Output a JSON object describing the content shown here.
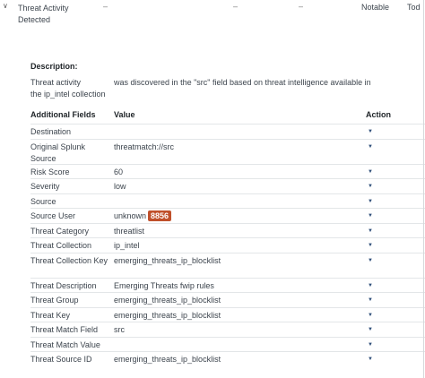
{
  "event": {
    "title_line1": "Threat Activity",
    "title_line2": "Detected",
    "dash": "–",
    "urgency": "Notable",
    "owner": "Tod"
  },
  "description": {
    "label": "Description:",
    "line1_a": "Threat activity",
    "line1_b": "was discovered in the \"src\" field based on threat intelligence available in",
    "line2": "the ip_intel collection"
  },
  "table": {
    "headers": {
      "field": "Additional Fields",
      "value": "Value",
      "action": "Action"
    },
    "action_icon": "caret-down-icon",
    "rows": [
      {
        "field": "Destination",
        "value": "",
        "action": "▼"
      },
      {
        "field": "Original Splunk Source",
        "value": "threatmatch://src",
        "action": "▼"
      },
      {
        "field": "Risk Score",
        "value": "60",
        "action": "▼"
      },
      {
        "field": "Severity",
        "value": "low",
        "action": "▼"
      },
      {
        "field": "Source",
        "value": "",
        "action": "▼"
      },
      {
        "field": "Source User",
        "value": "unknown",
        "badge": "8856",
        "action": "▼"
      },
      {
        "field": "Threat Category",
        "value": "threatlist",
        "action": "▼"
      },
      {
        "field": "Threat Collection",
        "value": "ip_intel",
        "action": "▼"
      },
      {
        "field": "Threat Collection Key",
        "value": "emerging_threats_ip_blocklist",
        "action": "▼"
      },
      {
        "field": "Threat Description",
        "value": "Emerging Threats fwip rules",
        "action": "▼"
      },
      {
        "field": "Threat Group",
        "value": "emerging_threats_ip_blocklist",
        "action": "▼"
      },
      {
        "field": "Threat Key",
        "value": "emerging_threats_ip_blocklist",
        "action": "▼"
      },
      {
        "field": "Threat Match Field",
        "value": "src",
        "action": "▼"
      },
      {
        "field": "Threat Match Value",
        "value": "",
        "action": "▼"
      },
      {
        "field": "Threat Source ID",
        "value": "emerging_threats_ip_blocklist",
        "action": "▼"
      }
    ]
  },
  "colors": {
    "badge": "#c0502b",
    "text": "#3c444d",
    "header": "#1e2327",
    "action": "#2f4f7a"
  }
}
